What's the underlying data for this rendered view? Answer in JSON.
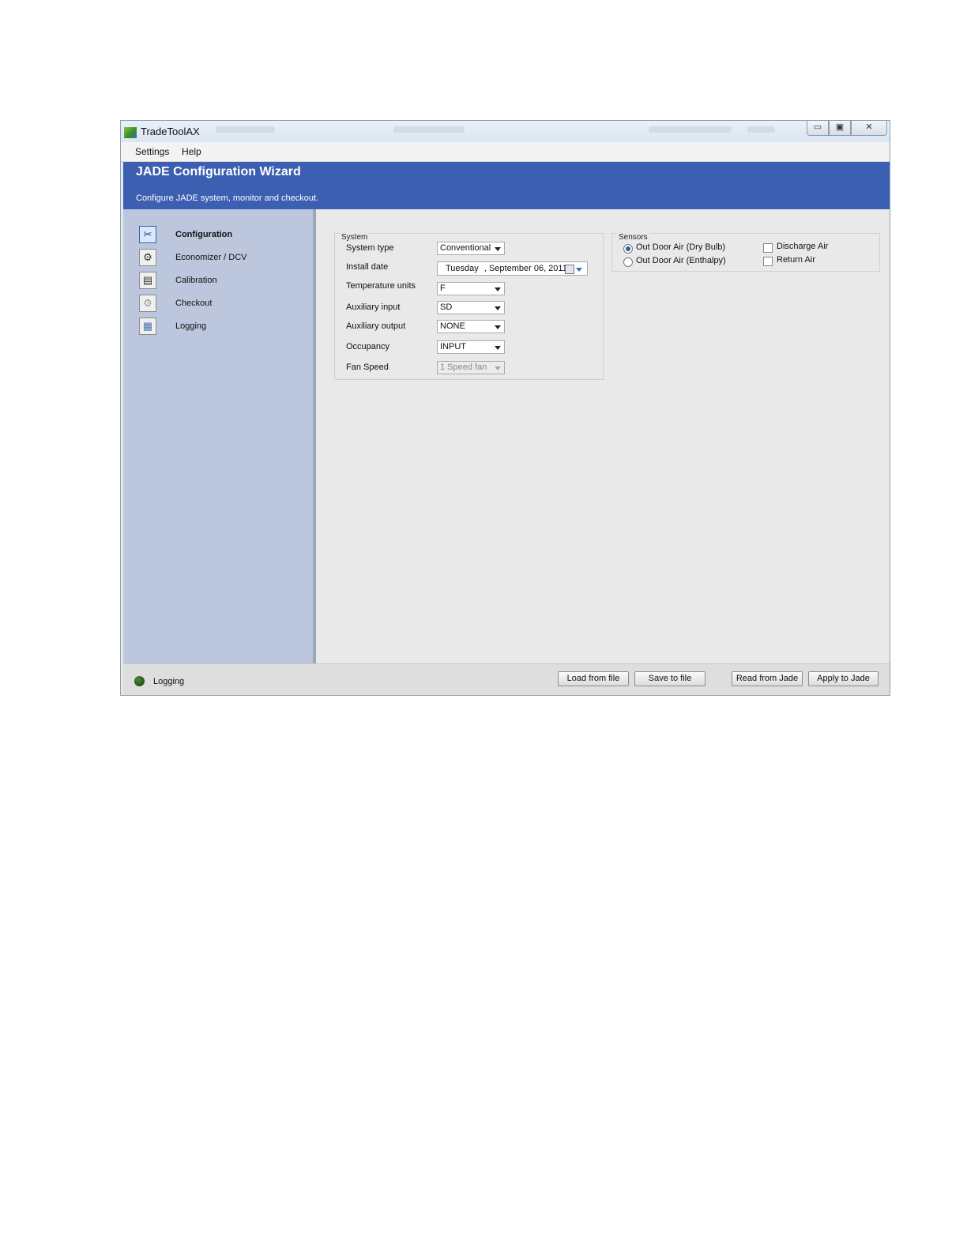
{
  "window": {
    "title": "TradeToolAX",
    "controls": [
      "minimize",
      "maximize",
      "close"
    ]
  },
  "menu": {
    "items": [
      "Settings",
      "Help"
    ]
  },
  "header": {
    "title": "JADE Configuration Wizard",
    "subtitle": "Configure JADE system, monitor and checkout."
  },
  "sidebar": {
    "items": [
      {
        "label": "Configuration",
        "icon": "tools-icon",
        "active": true
      },
      {
        "label": "Economizer / DCV",
        "icon": "economizer-icon",
        "active": false
      },
      {
        "label": "Calibration",
        "icon": "calibration-icon",
        "active": false
      },
      {
        "label": "Checkout",
        "icon": "gear-icon",
        "active": false
      },
      {
        "label": "Logging",
        "icon": "log-icon",
        "active": false
      }
    ]
  },
  "system": {
    "title": "System",
    "system_type": {
      "label": "System type",
      "value": "Conventional"
    },
    "install_date": {
      "label": "Install date",
      "day": "Tuesday",
      "date": ", September 06, 2011"
    },
    "temperature_units": {
      "label": "Temperature units",
      "value": "F"
    },
    "auxiliary_input": {
      "label": "Auxiliary input",
      "value": "SD"
    },
    "auxiliary_output": {
      "label": "Auxiliary output",
      "value": "NONE"
    },
    "occupancy": {
      "label": "Occupancy",
      "value": "INPUT"
    },
    "fan_speed": {
      "label": "Fan Speed",
      "value": "1 Speed fan",
      "disabled": true
    }
  },
  "sensors": {
    "title": "Sensors",
    "radios": [
      {
        "label": "Out Door Air (Dry Bulb)",
        "selected": true
      },
      {
        "label": "Out Door Air (Enthalpy)",
        "selected": false
      }
    ],
    "checkboxes": [
      {
        "label": "Discharge Air",
        "checked": false
      },
      {
        "label": "Return Air",
        "checked": false
      }
    ]
  },
  "status": {
    "label": "Logging",
    "led_color": "#1e5a18"
  },
  "buttons": {
    "load": "Load from file",
    "save": "Save to  file",
    "read": "Read from Jade",
    "apply": "Apply to Jade"
  },
  "colors": {
    "header_bg": "#3c5fb2",
    "sidebar_bg": "#bcc7dd",
    "content_bg": "#e9e9e9"
  }
}
